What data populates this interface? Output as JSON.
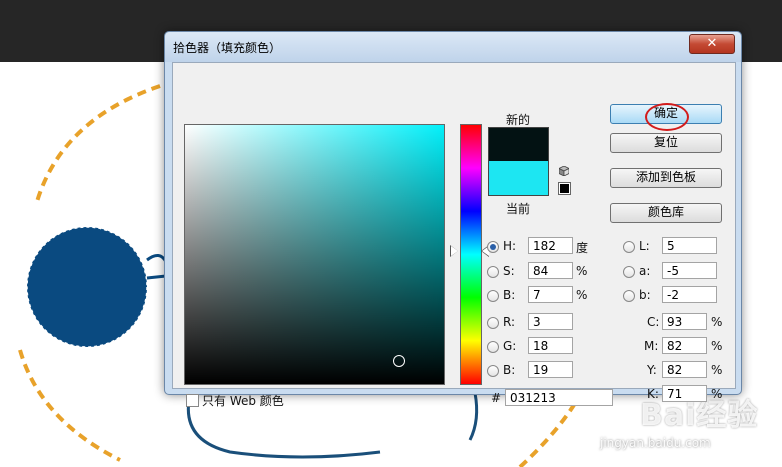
{
  "dialog": {
    "title": "拾色器（填充颜色）",
    "close_glyph": "✕"
  },
  "swatches": {
    "new_label": "新的",
    "current_label": "当前",
    "new_color": "#031213",
    "current_color": "#1de6f2"
  },
  "buttons": {
    "ok": "确定",
    "reset": "复位",
    "add_to_swatches": "添加到色板",
    "color_libraries": "颜色库"
  },
  "hsb": {
    "h_label": "H:",
    "h_value": "182",
    "h_unit": "度",
    "s_label": "S:",
    "s_value": "84",
    "s_unit": "%",
    "b_label": "B:",
    "b_value": "7",
    "b_unit": "%"
  },
  "rgb": {
    "r_label": "R:",
    "r_value": "3",
    "g_label": "G:",
    "g_value": "18",
    "b_label": "B:",
    "b_value": "19"
  },
  "lab": {
    "l_label": "L:",
    "l_value": "5",
    "a_label": "a:",
    "a_value": "-5",
    "b_label": "b:",
    "b_value": "-2"
  },
  "cmyk": {
    "c_label": "C:",
    "c_value": "93",
    "m_label": "M:",
    "m_value": "82",
    "y_label": "Y:",
    "y_value": "82",
    "k_label": "K:",
    "k_value": "71",
    "unit": "%"
  },
  "hex": {
    "label": "#",
    "value": "031213"
  },
  "websafe": {
    "label": "只有 Web 颜色",
    "checked": false
  },
  "colors": {
    "accent_ring": "#d21c1c",
    "hue_base": "#03f0fa",
    "artwork_blue": "#0a4a80",
    "artwork_orange": "#e8a22a"
  },
  "watermark": {
    "text": "Bai经验",
    "sub": "jingyan.baidu.com"
  }
}
